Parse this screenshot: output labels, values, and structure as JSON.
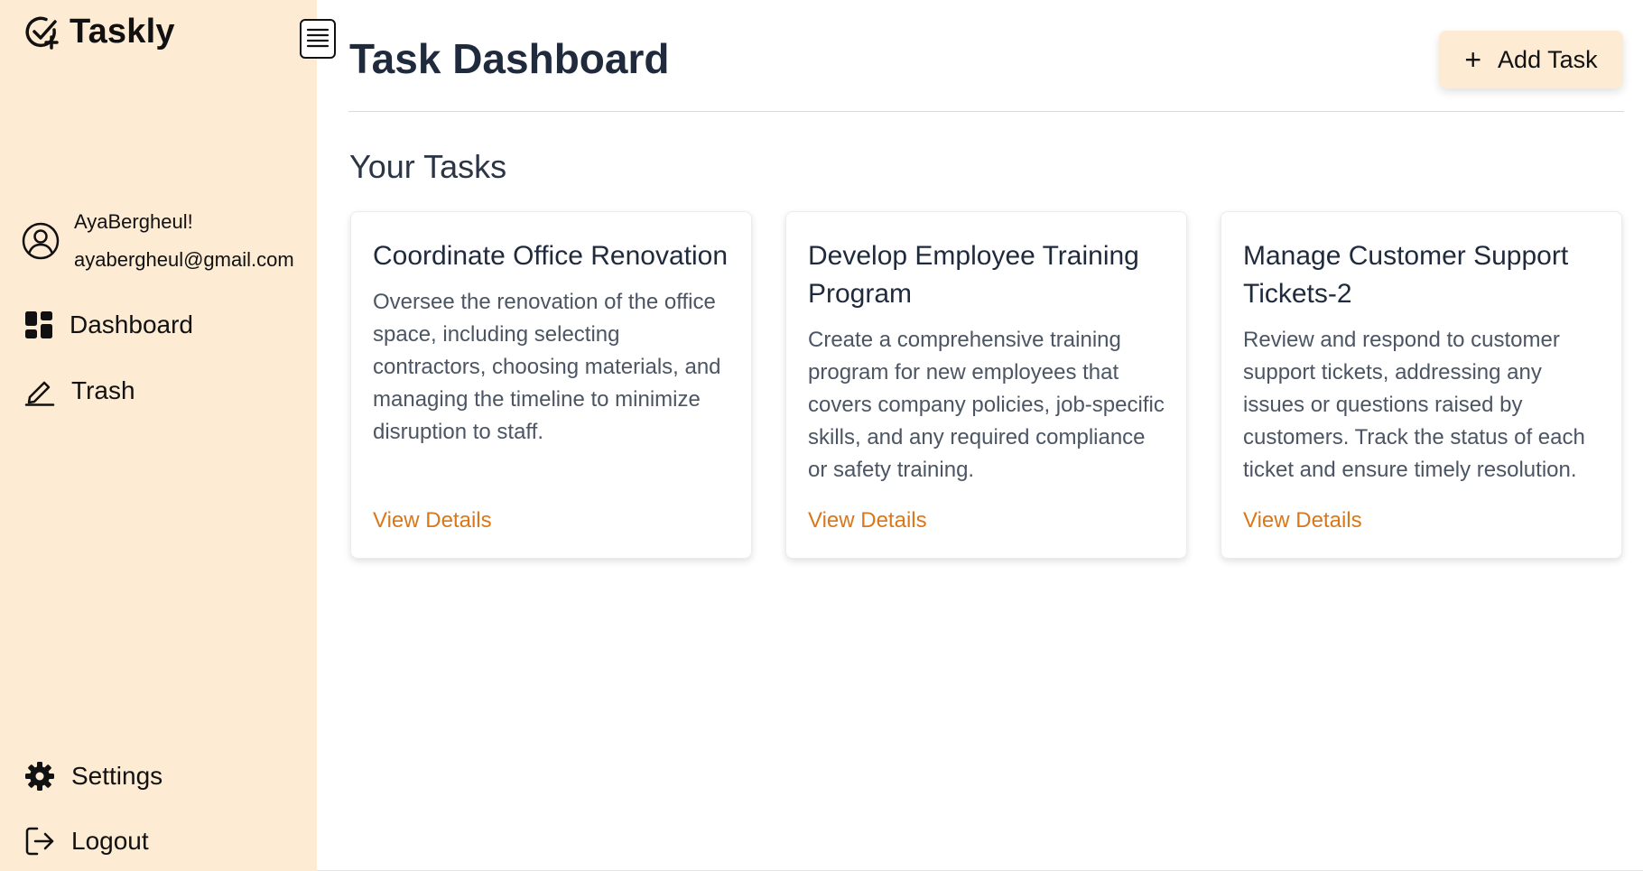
{
  "app": {
    "name": "Taskly",
    "accent_color": "#fdebd3",
    "link_color": "#d9771a",
    "logo_icon": "check-circle-plus-icon"
  },
  "sidebar": {
    "user": {
      "name": "AyaBergheul!",
      "email": "ayabergheul@gmail.com",
      "icon": "user-circle-icon"
    },
    "nav": [
      {
        "label": "Dashboard",
        "icon": "grid-icon"
      },
      {
        "label": "Trash",
        "icon": "pen-icon"
      }
    ],
    "bottom": [
      {
        "label": "Settings",
        "icon": "gear-icon"
      },
      {
        "label": "Logout",
        "icon": "logout-icon"
      }
    ]
  },
  "header": {
    "title": "Task Dashboard",
    "add_button": {
      "icon_text": "+",
      "label": "Add Task"
    },
    "menu_icon": "menu-lines-icon"
  },
  "main": {
    "section_title": "Your Tasks",
    "tasks": [
      {
        "title": "Coordinate Office Renovation",
        "description": "Oversee the renovation of the office space, including selecting contractors, choosing materials, and managing the timeline to minimize disruption to staff.",
        "link": "View Details"
      },
      {
        "title": "Develop Employee Training Program",
        "description": "Create a comprehensive training program for new employees that covers company policies, job-specific skills, and any required compliance or safety training.",
        "link": "View Details"
      },
      {
        "title": "Manage Customer Support Tickets-2",
        "description": "Review and respond to customer support tickets, addressing any issues or questions raised by customers. Track the status of each ticket and ensure timely resolution.",
        "link": "View Details"
      }
    ]
  }
}
